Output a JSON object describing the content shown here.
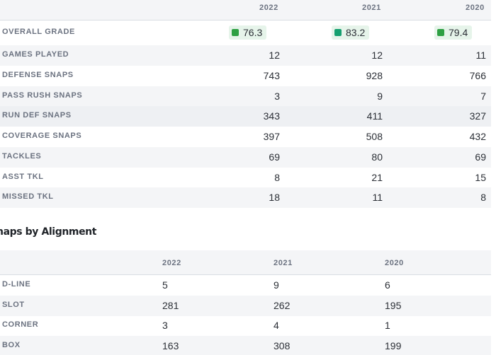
{
  "stats": {
    "columns": [
      "2022",
      "2021",
      "2020"
    ],
    "grade": {
      "label": "OVERALL GRADE",
      "values": [
        "76.3",
        "83.2",
        "79.4"
      ]
    },
    "rows": [
      {
        "label": "GAMES PLAYED",
        "values": [
          "12",
          "12",
          "11"
        ]
      },
      {
        "label": "DEFENSE SNAPS",
        "values": [
          "743",
          "928",
          "766"
        ]
      },
      {
        "label": "PASS RUSH SNAPS",
        "values": [
          "3",
          "9",
          "7"
        ]
      },
      {
        "label": "RUN DEF SNAPS",
        "values": [
          "343",
          "411",
          "327"
        ]
      },
      {
        "label": "COVERAGE SNAPS",
        "values": [
          "397",
          "508",
          "432"
        ]
      },
      {
        "label": "TACKLES",
        "values": [
          "69",
          "80",
          "69"
        ]
      },
      {
        "label": "ASST TKL",
        "values": [
          "8",
          "21",
          "15"
        ]
      },
      {
        "label": "MISSED TKL",
        "values": [
          "18",
          "11",
          "8"
        ]
      }
    ]
  },
  "alignment": {
    "title": "naps by Alignment",
    "columns": [
      "2022",
      "2021",
      "2020"
    ],
    "rows": [
      {
        "label": "D-LINE",
        "values": [
          "5",
          "9",
          "6"
        ]
      },
      {
        "label": "SLOT",
        "values": [
          "281",
          "262",
          "195"
        ]
      },
      {
        "label": "CORNER",
        "values": [
          "3",
          "4",
          "1"
        ]
      },
      {
        "label": "BOX",
        "values": [
          "163",
          "308",
          "199"
        ]
      }
    ]
  },
  "colors": {
    "grade_good": "#2ea043",
    "grade_high": "#16a070",
    "grade_bg": "#e6f4ea",
    "tab_accent": "#3b6fd6"
  }
}
